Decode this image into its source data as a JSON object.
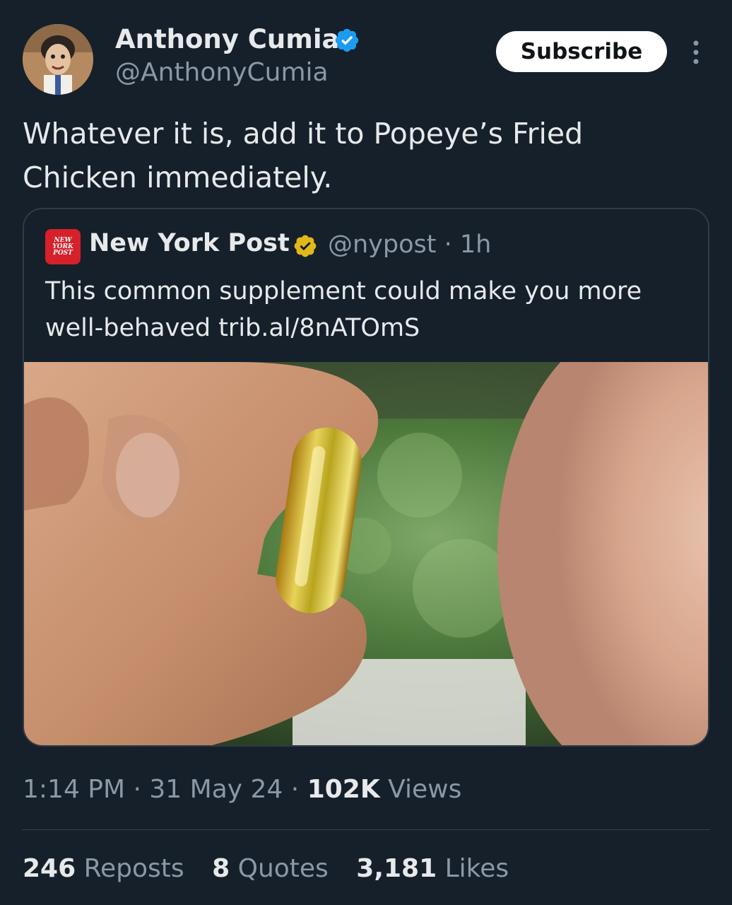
{
  "tweet": {
    "author": {
      "display_name": "Anthony Cumia",
      "handle": "@AnthonyCumia",
      "verified_color": "#1d9bf0"
    },
    "subscribe_label": "Subscribe",
    "text": "Whatever it is, add it to Popeye’s Fried Chicken immediately.",
    "quoted": {
      "logo_text": "NEW\nYORK\nPOST",
      "display_name": "New York Post",
      "verified_color": "#e2b719",
      "handle": "@nypost",
      "separator": " · ",
      "age": "1h",
      "text": "This common supplement could make you more well-behaved trib.al/8nATOmS"
    },
    "meta": {
      "time": "1:14 PM",
      "date": "31 May 24",
      "separator": " · ",
      "views_count": "102K",
      "views_label": " Views"
    },
    "stats": {
      "reposts_count": "246",
      "reposts_label": " Reposts",
      "quotes_count": "8",
      "quotes_label": " Quotes",
      "likes_count": "3,181",
      "likes_label": " Likes"
    }
  },
  "colors": {
    "background": "#15202b",
    "text": "#e7e9ea",
    "secondary": "#8b98a5",
    "border": "#2f3b47"
  }
}
